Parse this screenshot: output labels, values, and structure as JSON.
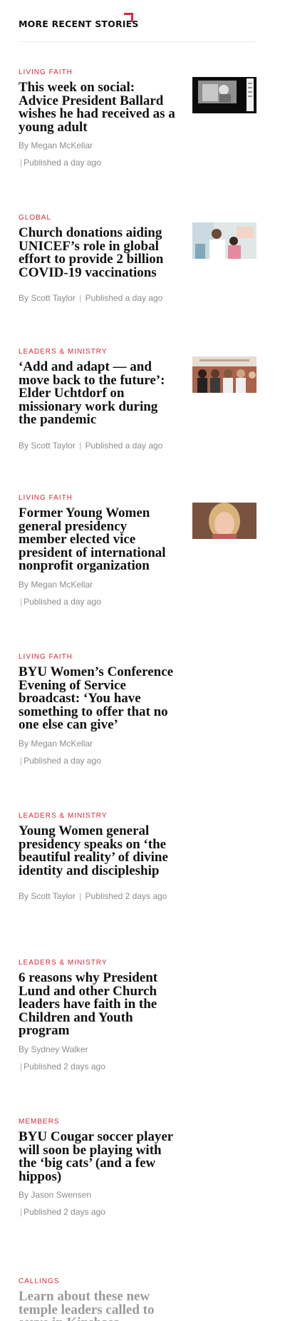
{
  "section": {
    "title": "MORE RECENT STORIES"
  },
  "stories": [
    {
      "category": "LIVING FAITH",
      "headline": "This week on social: Advice President Ballard wishes he had received as a young adult",
      "byline": "By Megan McKellar",
      "published": "Published a day ago",
      "thumbnail": "social-post-photo"
    },
    {
      "category": "GLOBAL",
      "headline": "Church donations aiding UNICEF’s role in global effort to provide 2 billion COVID-19 vaccinations",
      "byline": "By Scott Taylor",
      "published": "Published a day ago",
      "thumbnail": "vaccination-photo"
    },
    {
      "category": "LEADERS & MINISTRY",
      "headline": "‘Add and adapt — and move back to the future’: Elder Uchtdorf on missionary work during the pandemic",
      "byline": "By Scott Taylor",
      "published": "Published a day ago",
      "thumbnail": "missionaries-photo"
    },
    {
      "category": "LIVING FAITH",
      "headline": "Former Young Women general presidency member elected vice president of international nonprofit organization",
      "byline": "By Megan McKellar",
      "published": "Published a day ago",
      "thumbnail": "portrait-photo"
    },
    {
      "category": "LIVING FAITH",
      "headline": "BYU Women’s Conference Evening of Service broadcast: ‘You have something to offer that no one else can give’",
      "byline": "By Megan McKellar",
      "published": "Published a day ago"
    },
    {
      "category": "LEADERS & MINISTRY",
      "headline": "Young Women general presidency speaks on ‘the beautiful reality’ of divine identity and discipleship",
      "byline": "By Scott Taylor",
      "published": "Published 2 days ago"
    },
    {
      "category": "LEADERS & MINISTRY",
      "headline": "6 reasons why President Lund and other Church leaders have faith in the Children and Youth program",
      "byline": "By Sydney Walker",
      "published": "Published 2 days ago"
    },
    {
      "category": "MEMBERS",
      "headline": "BYU Cougar soccer player will soon be playing with the ‘big cats’ (and a few hippos)",
      "byline": "By Jason Swensen",
      "published": "Published 2 days ago"
    },
    {
      "category": "CALLINGS",
      "headline": "Learn about these new temple leaders called to serve in Kinshasa"
    }
  ],
  "colors": {
    "accent": "#d5293a",
    "meta": "#8d8d8d"
  }
}
